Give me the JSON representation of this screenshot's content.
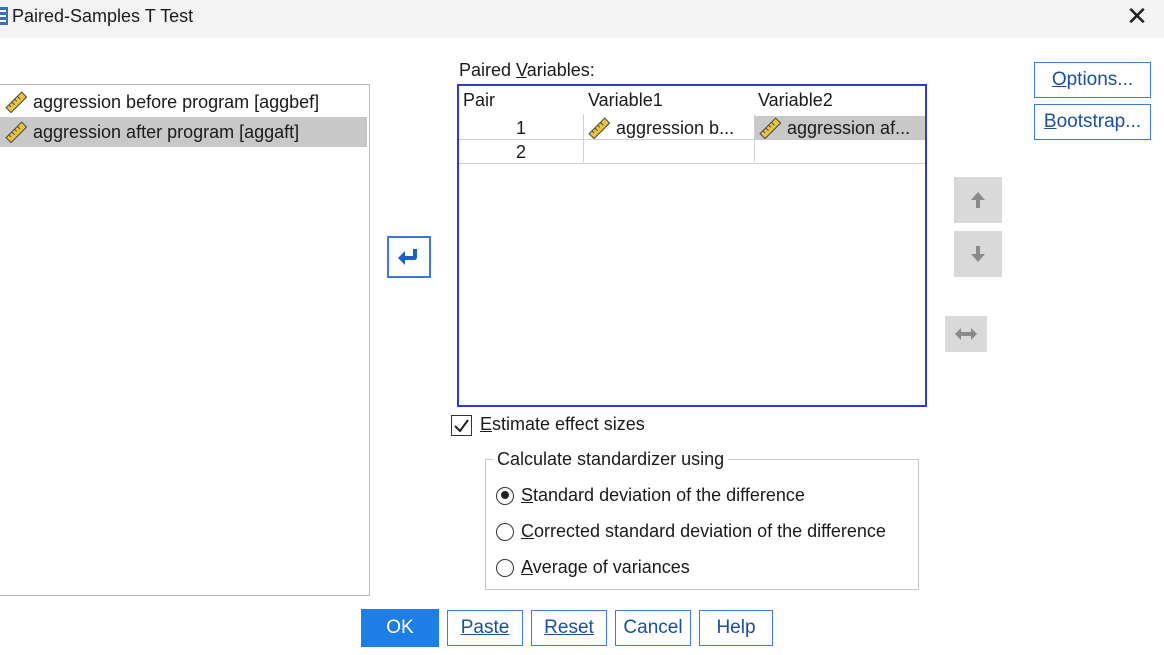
{
  "window": {
    "title": "Paired-Samples T Test",
    "close_icon": "close-icon"
  },
  "source_variables": [
    {
      "label": "aggression before program [aggbef]",
      "icon": "scale-ruler-icon",
      "selected": false
    },
    {
      "label": "aggression after program [aggaft]",
      "icon": "scale-ruler-icon",
      "selected": true
    }
  ],
  "paired_variables": {
    "label_pre": "Paired ",
    "label_mnemonic": "V",
    "label_post": "ariables:",
    "headers": {
      "pair": "Pair",
      "var1": "Variable1",
      "var2": "Variable2"
    },
    "rows": [
      {
        "pair": "1",
        "var1": "aggression b...",
        "var2": "aggression af..."
      },
      {
        "pair": "2",
        "var1": "",
        "var2": ""
      }
    ]
  },
  "side_buttons": {
    "options": {
      "mnemonic": "O",
      "rest": "ptions..."
    },
    "bootstrap": {
      "mnemonic": "B",
      "rest": "ootstrap..."
    }
  },
  "effect_sizes": {
    "checked": true,
    "mnemonic": "E",
    "rest": "stimate effect sizes"
  },
  "standardizer": {
    "legend": "Calculate standardizer using",
    "options": [
      {
        "mnemonic": "S",
        "rest": "tandard deviation of the difference",
        "selected": true
      },
      {
        "mnemonic": "C",
        "rest": "orrected standard deviation of the difference",
        "selected": false
      },
      {
        "mnemonic": "A",
        "rest": "verage of variances",
        "selected": false
      }
    ]
  },
  "footer": {
    "ok": "OK",
    "paste": {
      "mnemonic": "P",
      "rest": "aste"
    },
    "reset": {
      "mnemonic": "R",
      "rest": "eset"
    },
    "cancel": "Cancel",
    "help": "Help"
  },
  "colors": {
    "accent": "#1f7de8",
    "table_border": "#2f3bd0",
    "selection": "#c8c8c8"
  }
}
